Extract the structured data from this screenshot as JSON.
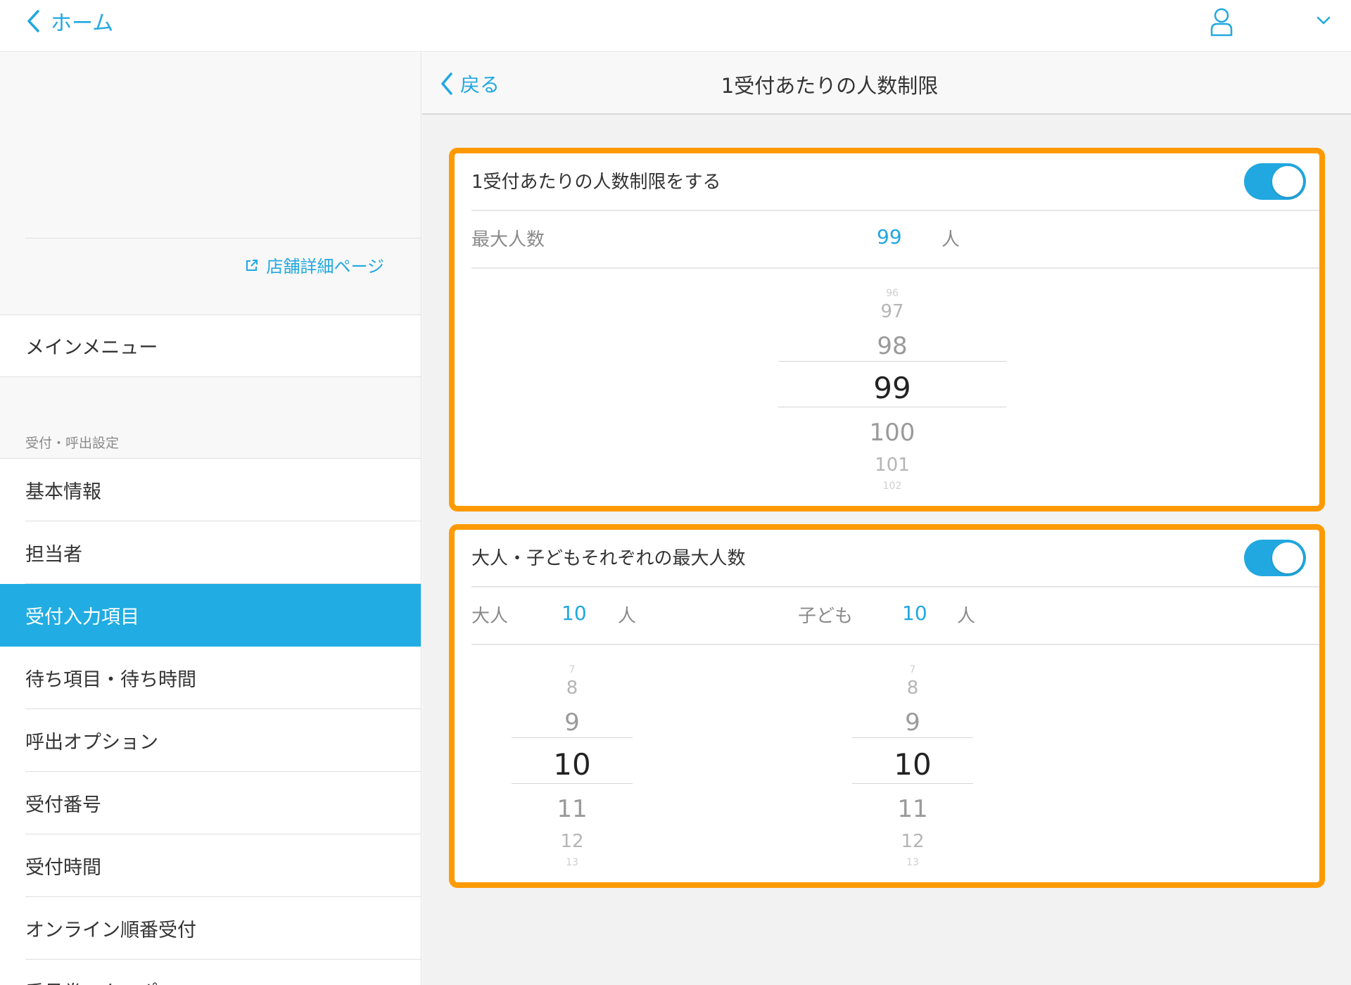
{
  "topbar": {
    "home_label": "ホーム"
  },
  "sidebar": {
    "store_link": "店舗詳細ページ",
    "main_menu": "メインメニュー",
    "section_label": "受付・呼出設定",
    "items": [
      {
        "label": "基本情報"
      },
      {
        "label": "担当者"
      },
      {
        "label": "受付入力項目"
      },
      {
        "label": "待ち項目・待ち時間"
      },
      {
        "label": "呼出オプション"
      },
      {
        "label": "受付番号"
      },
      {
        "label": "受付時間"
      },
      {
        "label": "オンライン順番受付"
      },
      {
        "label": "番号券・クーポン"
      }
    ],
    "active_index": 2
  },
  "main": {
    "back_label": "戻る",
    "title": "1受付あたりの人数制限"
  },
  "card1": {
    "title": "1受付あたりの人数制限をする",
    "toggle_on": true,
    "max_label": "最大人数",
    "max_value": "99",
    "unit": "人",
    "picker": [
      "96",
      "97",
      "98",
      "99",
      "100",
      "101",
      "102"
    ]
  },
  "card2": {
    "title": "大人・子どもそれぞれの最大人数",
    "toggle_on": true,
    "adult_label": "大人",
    "adult_value": "10",
    "adult_unit": "人",
    "child_label": "子ども",
    "child_value": "10",
    "child_unit": "人",
    "adult_picker": [
      "7",
      "8",
      "9",
      "10",
      "11",
      "12",
      "13"
    ],
    "child_picker": [
      "7",
      "8",
      "9",
      "10",
      "11",
      "12",
      "13"
    ]
  },
  "colors": {
    "accent": "#21a8e0",
    "highlight": "#ff9a00",
    "active_nav": "#21ade3"
  }
}
